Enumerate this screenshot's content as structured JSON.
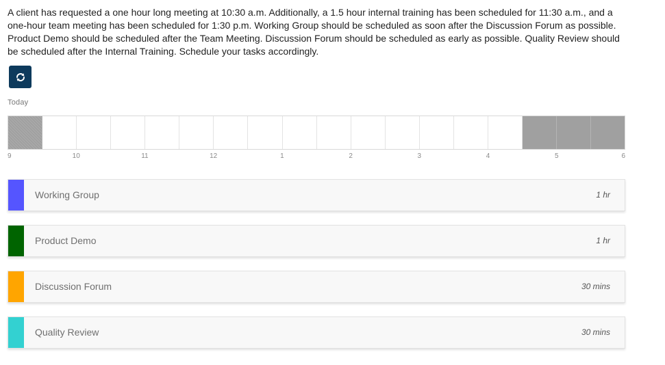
{
  "instructions": "A client has requested a one hour long meeting at 10:30 a.m. Additionally, a 1.5 hour internal training has been scheduled for 11:30 a.m., and a one-hour team meeting has been scheduled for 1:30 p.m. Working Group should be scheduled as soon after the Discussion Forum as possible. Product Demo should be scheduled after the Team Meeting. Discussion Forum should be scheduled as early as possible. Quality Review should be scheduled after the Internal Training. Schedule your tasks accordingly.",
  "refresh_button": {
    "icon": "refresh-icon"
  },
  "day_label": "Today",
  "timeline": {
    "slot_states": [
      "blocked",
      "open",
      "open",
      "open",
      "open",
      "open",
      "open",
      "open",
      "open",
      "open",
      "open",
      "open",
      "open",
      "open",
      "open",
      "blocked",
      "blocked",
      "blocked"
    ],
    "blocked_color": "#a0a0a0",
    "hour_labels": [
      "9",
      "10",
      "11",
      "12",
      "1",
      "2",
      "3",
      "4",
      "5",
      "6"
    ]
  },
  "tasks": [
    {
      "name": "Working Group",
      "duration": "1 hr",
      "color": "#5555ff"
    },
    {
      "name": "Product Demo",
      "duration": "1 hr",
      "color": "#006400"
    },
    {
      "name": "Discussion Forum",
      "duration": "30 mins",
      "color": "#ffa500"
    },
    {
      "name": "Quality Review",
      "duration": "30 mins",
      "color": "#33d1d1"
    }
  ]
}
